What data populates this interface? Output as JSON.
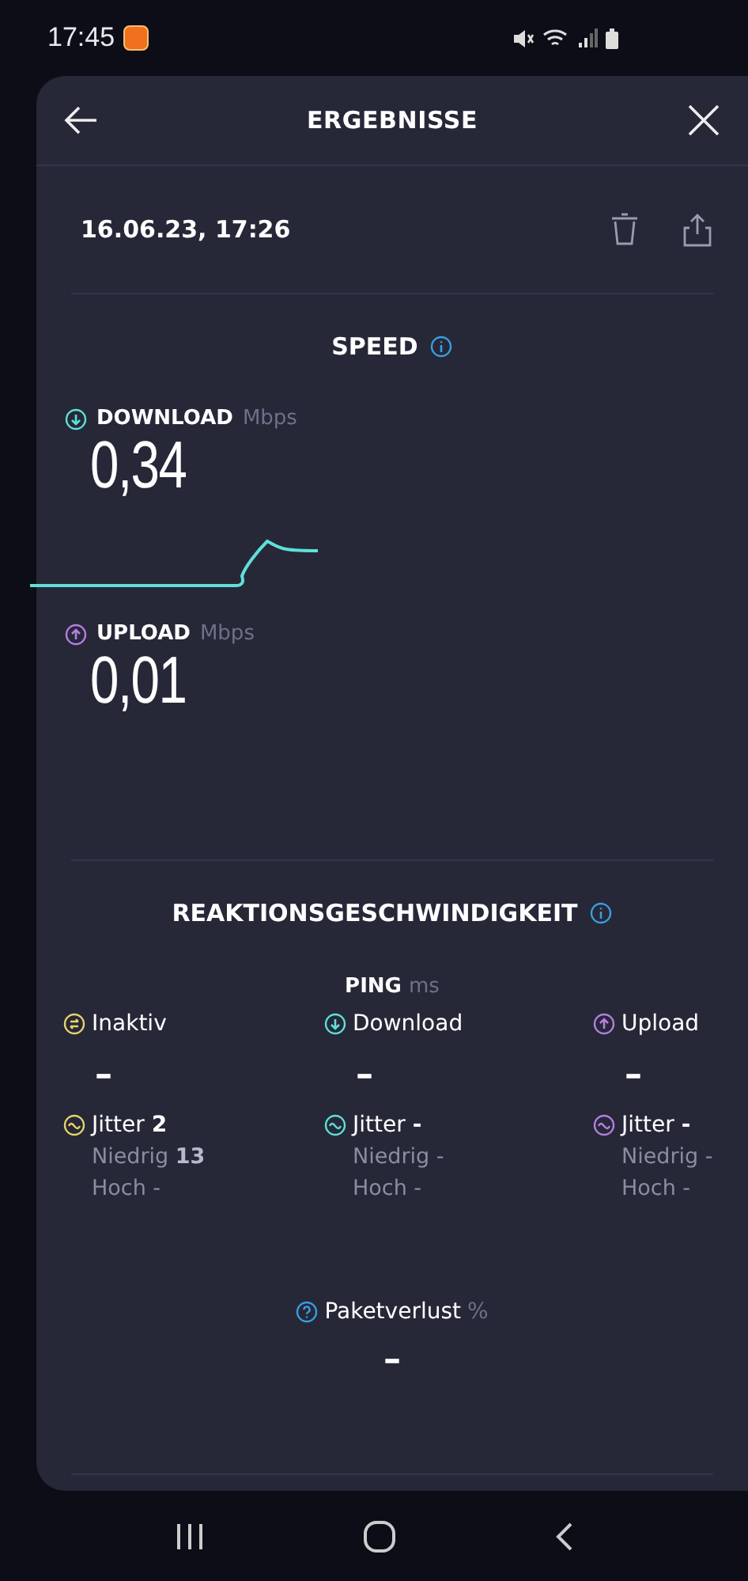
{
  "status_bar": {
    "time": "17:45"
  },
  "header": {
    "title": "ERGEBNISSE"
  },
  "result": {
    "date": "16.06.23, 17:26"
  },
  "speed": {
    "title": "SPEED",
    "metrics": [
      {
        "kind": "download",
        "label": "DOWNLOAD",
        "unit": "Mbps",
        "value": "0,34"
      },
      {
        "kind": "upload",
        "label": "UPLOAD",
        "unit": "Mbps",
        "value": "0,01"
      }
    ]
  },
  "latency": {
    "title": "REAKTIONSGESCHWINDIGKEIT",
    "ping_label": "PING",
    "ping_unit": "ms",
    "columns": [
      {
        "kind": "idle",
        "label": "Inaktiv",
        "value": "–",
        "jitter": "Jitter **2**",
        "low": "Niedrig **13**",
        "high": "Hoch -"
      },
      {
        "kind": "download",
        "label": "Download",
        "value": "–",
        "jitter": "Jitter **-**",
        "low": "Niedrig -",
        "high": "Hoch -"
      },
      {
        "kind": "upload",
        "label": "Upload",
        "value": "–",
        "jitter": "Jitter **-**",
        "low": "Niedrig -",
        "high": "Hoch -"
      }
    ],
    "packet_loss": {
      "label": "Paketverlust",
      "unit": "%",
      "value": "–"
    }
  }
}
